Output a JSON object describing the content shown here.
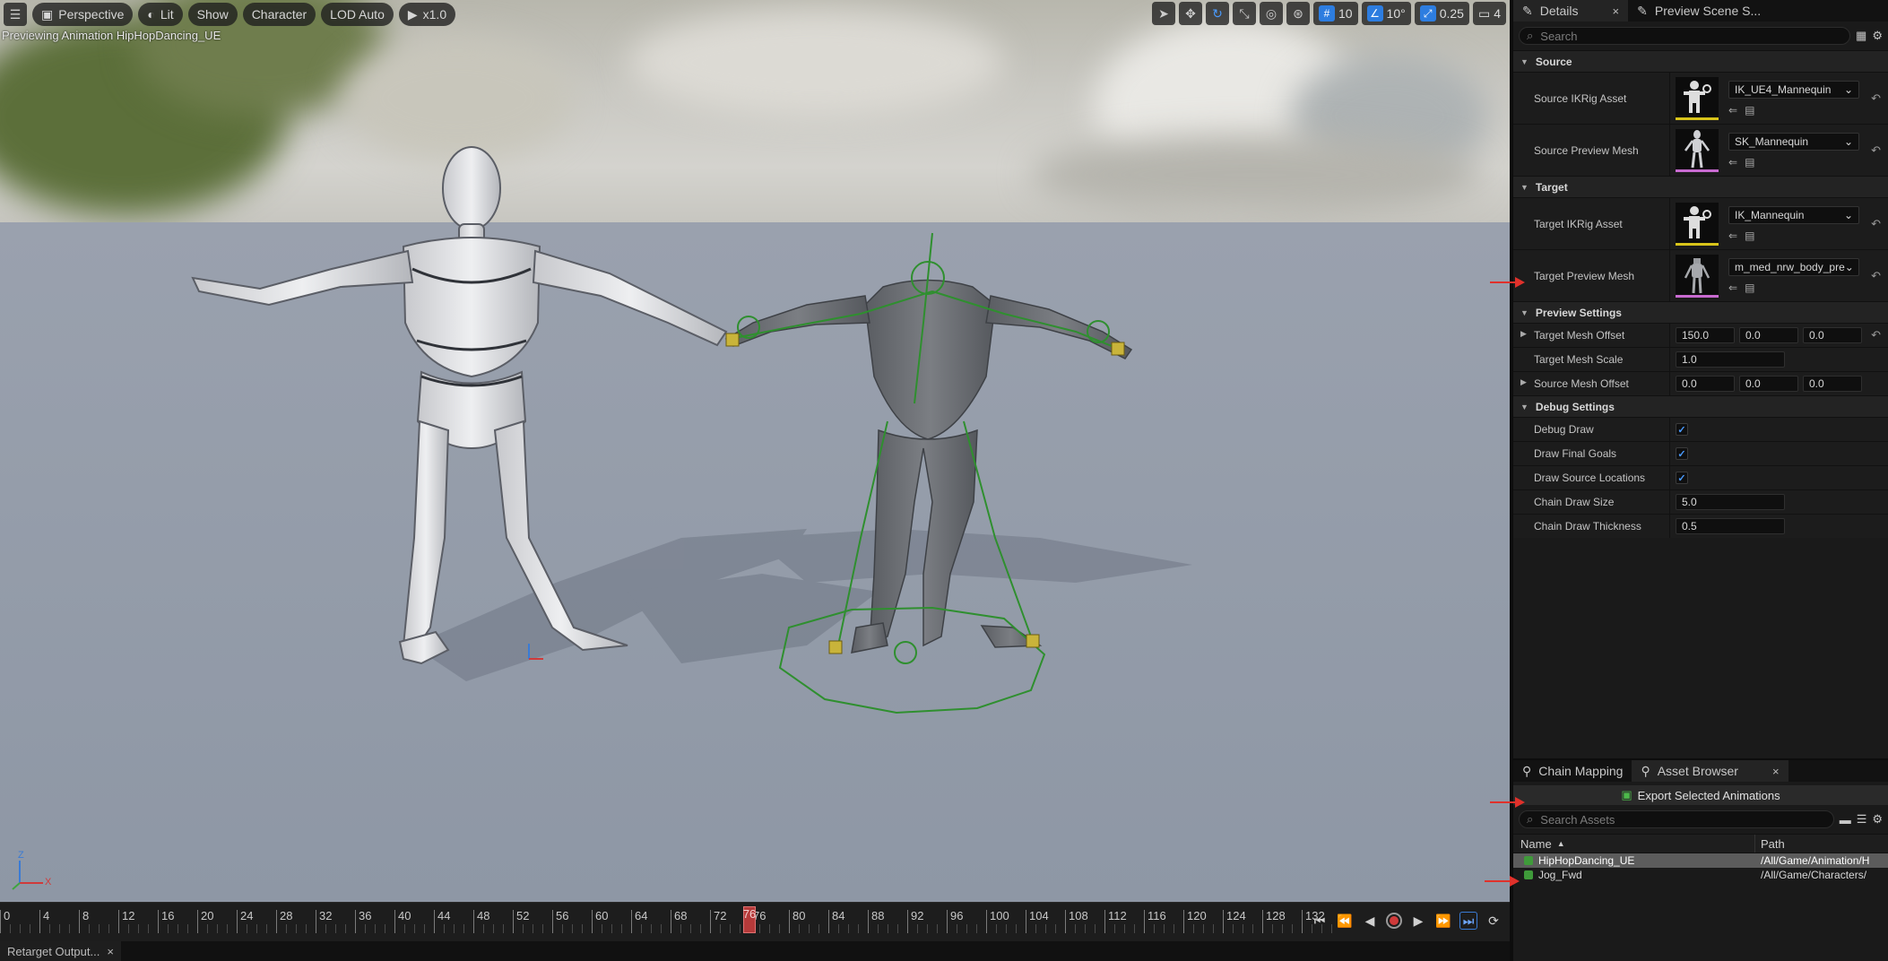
{
  "toolbar": {
    "menu_icon": "hamburger-icon",
    "perspective": "Perspective",
    "lit": "Lit",
    "show": "Show",
    "character": "Character",
    "lod": "LOD Auto",
    "speed": "x1.0",
    "grid_snap": "10",
    "rotation_snap": "10°",
    "scale_snap": "0.25",
    "camera_speed": "4"
  },
  "viewport": {
    "preview_label": "Previewing Animation HipHopDancing_UE",
    "axis_z": "Z",
    "axis_x": "X"
  },
  "timeline": {
    "ticks": [
      "0",
      "4",
      "8",
      "12",
      "16",
      "20",
      "24",
      "28",
      "32",
      "36",
      "40",
      "44",
      "48",
      "52",
      "56",
      "60",
      "64",
      "68",
      "72",
      "76",
      "80",
      "84",
      "88",
      "92",
      "96",
      "100",
      "104",
      "108",
      "112",
      "116",
      "120",
      "124",
      "128",
      "132"
    ],
    "current_frame": "76"
  },
  "bottom_tab": {
    "label": "Retarget Output...",
    "close": "×"
  },
  "details": {
    "tab_details": "Details",
    "tab_close": "×",
    "tab_preview": "Preview Scene S...",
    "search_placeholder": "Search",
    "source": {
      "title": "Source",
      "ikrig_label": "Source IKRig Asset",
      "ikrig_value": "IK_UE4_Mannequin",
      "mesh_label": "Source Preview Mesh",
      "mesh_value": "SK_Mannequin"
    },
    "target": {
      "title": "Target",
      "ikrig_label": "Target IKRig Asset",
      "ikrig_value": "IK_Mannequin",
      "mesh_label": "Target Preview Mesh",
      "mesh_value": "m_med_nrw_body_pre"
    },
    "preview": {
      "title": "Preview Settings",
      "offset_label": "Target Mesh Offset",
      "offset_x": "150.0",
      "offset_y": "0.0",
      "offset_z": "0.0",
      "scale_label": "Target Mesh Scale",
      "scale_value": "1.0",
      "source_offset_label": "Source Mesh Offset",
      "src_x": "0.0",
      "src_y": "0.0",
      "src_z": "0.0"
    },
    "debug": {
      "title": "Debug Settings",
      "draw_label": "Debug Draw",
      "goals_label": "Draw Final Goals",
      "locations_label": "Draw Source Locations",
      "chain_size_label": "Chain Draw Size",
      "chain_size_value": "5.0",
      "chain_thick_label": "Chain Draw Thickness",
      "chain_thick_value": "0.5",
      "draw_checked": true,
      "goals_checked": true,
      "locations_checked": true
    }
  },
  "asset_browser": {
    "tab_chain": "Chain Mapping",
    "tab_assets": "Asset Browser",
    "tab_close": "×",
    "export_label": "Export Selected Animations",
    "search_placeholder": "Search Assets",
    "col_name": "Name",
    "col_path": "Path",
    "rows": [
      {
        "name": "HipHopDancing_UE",
        "path": "/All/Game/Animation/H",
        "selected": true
      },
      {
        "name": "Jog_Fwd",
        "path": "/All/Game/Characters/",
        "selected": false
      }
    ]
  },
  "colors": {
    "accent": "#2d7de0",
    "playhead": "#b53a3a",
    "annotation_arrow": "#e0312b",
    "debug_green": "#2f8f2f"
  }
}
